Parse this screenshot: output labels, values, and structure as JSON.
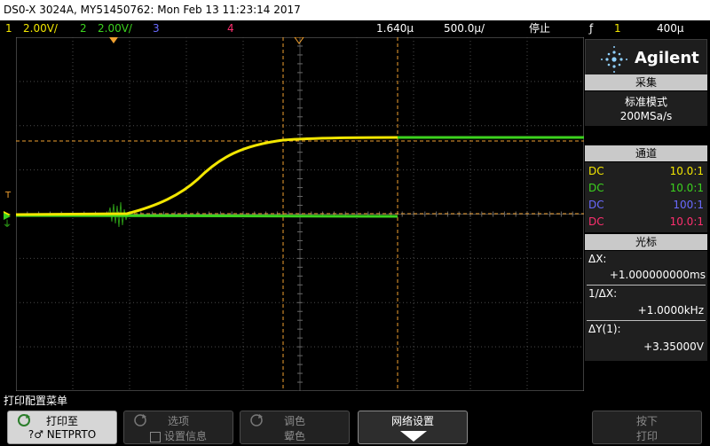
{
  "titlebar": {
    "text": "DS0-X 3024A, MY51450762: Mon Feb 13 11:23:14 2017"
  },
  "status": {
    "ch1_num": "1",
    "ch1_scale": "2.00V/",
    "ch2_num": "2",
    "ch2_scale": "2.00V/",
    "ch3_num": "3",
    "ch4_num": "4",
    "time_offset": "1.640µ",
    "timebase": "500.0µ/",
    "run_state": "停止",
    "trig_icon": "ƒ",
    "trig_src": "1",
    "trig_level": "400µ"
  },
  "colors": {
    "ch1": "#f2e600",
    "ch2": "#3cd21e",
    "ch3": "#6a6aff",
    "ch4": "#ff2f6f",
    "cursor": "#f0a030"
  },
  "panel": {
    "brand": "Agilent",
    "acq_head": "采集",
    "acq_mode": "标准模式",
    "acq_rate": "200MSa/s",
    "chan_head": "通道",
    "channels": [
      {
        "coupling": "DC",
        "probe": "10.0:1"
      },
      {
        "coupling": "DC",
        "probe": "10.0:1"
      },
      {
        "coupling": "DC",
        "probe": "100:1"
      },
      {
        "coupling": "DC",
        "probe": "10.0:1"
      }
    ],
    "cursor_head": "光标",
    "dx_label": "ΔX:",
    "dx_value": "+1.000000000ms",
    "invdx_label": "1/ΔX:",
    "invdx_value": "+1.0000kHz",
    "dy_label": "ΔY(1):",
    "dy_value": "+3.35000V"
  },
  "menu": {
    "title": "打印配置菜单",
    "keys": [
      {
        "line1": "打印至",
        "line2": "?♂ NETPRTO"
      },
      {
        "line1": "选项",
        "line2": "设置信息"
      },
      {
        "line1": "调色",
        "line2": "颦色"
      },
      {
        "line1": "网络设置",
        "line2": ""
      },
      {
        "line1": "按下",
        "line2": "打印"
      }
    ]
  }
}
